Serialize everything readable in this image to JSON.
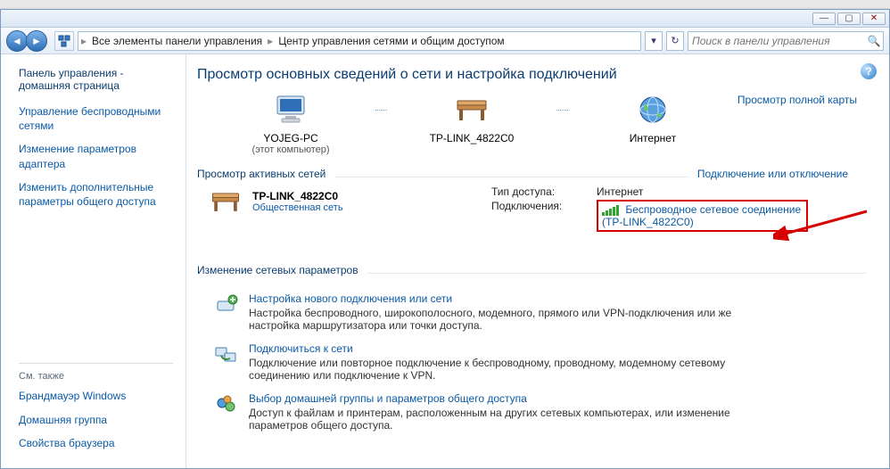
{
  "chrome": {
    "minimize": "—",
    "maximize": "▢",
    "close": "✕"
  },
  "toolbar": {
    "back": "◄",
    "forward": "►",
    "crumb1": "Все элементы панели управления",
    "crumb2": "Центр управления сетями и общим доступом",
    "search_placeholder": "Поиск в панели управления",
    "refresh": "↻"
  },
  "sidebar": {
    "home": "Панель управления - домашняя страница",
    "links": [
      "Управление беспроводными сетями",
      "Изменение параметров адаптера",
      "Изменить дополнительные параметры общего доступа"
    ],
    "see_also_title": "См. также",
    "see_also": [
      "Брандмауэр Windows",
      "Домашняя группа",
      "Свойства браузера"
    ]
  },
  "main": {
    "heading": "Просмотр основных сведений о сети и настройка подключений",
    "full_map_link": "Просмотр полной карты",
    "map": {
      "node1_name": "YOJEG-PC",
      "node1_sub": "(этот компьютер)",
      "node2_name": "TP-LINK_4822C0",
      "node3_name": "Интернет"
    },
    "active_nets_heading": "Просмотр активных сетей",
    "connect_toggle_link": "Подключение или отключение",
    "active_net": {
      "name": "TP-LINK_4822C0",
      "type_link": "Общественная сеть",
      "access_label": "Тип доступа:",
      "access_value": "Интернет",
      "conn_label": "Подключения:",
      "conn_link": "Беспроводное сетевое соединение",
      "conn_sub": "(TP-LINK_4822C0)"
    },
    "settings_heading": "Изменение сетевых параметров",
    "tasks": [
      {
        "title": "Настройка нового подключения или сети",
        "desc": "Настройка беспроводного, широкополосного, модемного, прямого или VPN-подключения или же настройка маршрутизатора или точки доступа."
      },
      {
        "title": "Подключиться к сети",
        "desc": "Подключение или повторное подключение к беспроводному, проводному, модемному сетевому соединению или подключение к VPN."
      },
      {
        "title": "Выбор домашней группы и параметров общего доступа",
        "desc": "Доступ к файлам и принтерам, расположенным на других сетевых компьютерах, или изменение параметров общего доступа."
      }
    ]
  }
}
